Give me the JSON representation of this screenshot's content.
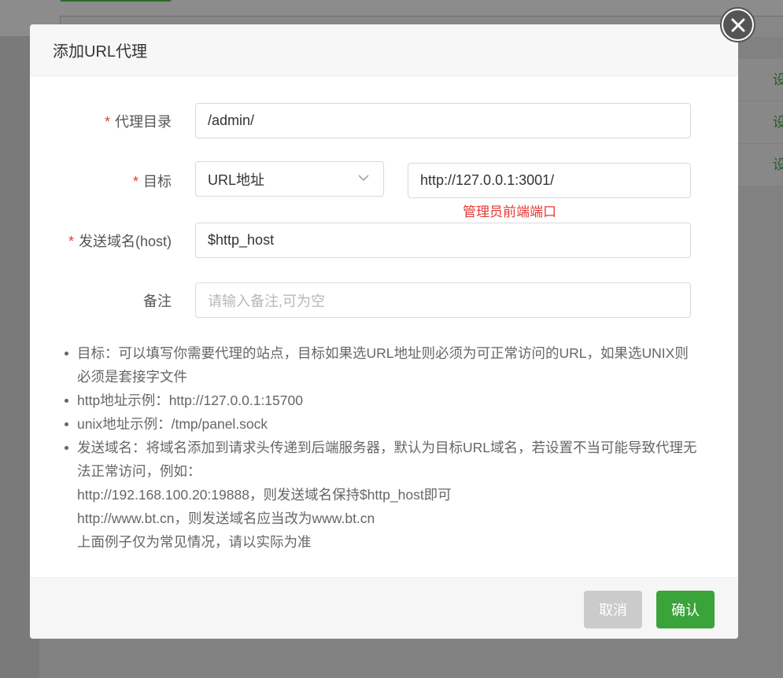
{
  "background": {
    "row_labels": [
      "设",
      "设",
      "设"
    ]
  },
  "modal": {
    "title": "添加URL代理",
    "close_icon": "close-circle-icon",
    "form": {
      "proxy_dir": {
        "label": "代理目录",
        "required": "*",
        "value": "/admin/"
      },
      "target": {
        "label": "目标",
        "required": "*",
        "type_selected": "URL地址",
        "url_value": "http://127.0.0.1:3001/",
        "note": "管理员前端端口"
      },
      "host": {
        "label": "发送域名(host)",
        "required": "*",
        "value": "$http_host"
      },
      "remark": {
        "label": "备注",
        "placeholder": "请输入备注,可为空"
      }
    },
    "tips": [
      {
        "lines": [
          "目标：可以填写你需要代理的站点，目标如果选URL地址则必须为可正常访问的URL，如果选UNIX则",
          "必须是套接字文件"
        ]
      },
      {
        "lines": [
          "http地址示例：http://127.0.0.1:15700"
        ]
      },
      {
        "lines": [
          "unix地址示例：/tmp/panel.sock"
        ]
      },
      {
        "lines": [
          "发送域名：将域名添加到请求头传递到后端服务器，默认为目标URL域名，若设置不当可能导致代理无",
          "法正常访问，例如：",
          "http://192.168.100.20:19888，则发送域名保持$http_host即可",
          "http://www.bt.cn，则发送域名应当改为www.bt.cn",
          "上面例子仅为常见情况，请以实际为准"
        ]
      }
    ],
    "footer": {
      "cancel_label": "取消",
      "confirm_label": "确认"
    }
  },
  "colors": {
    "accent_green": "#3aa33a",
    "required_red": "#e53935"
  }
}
